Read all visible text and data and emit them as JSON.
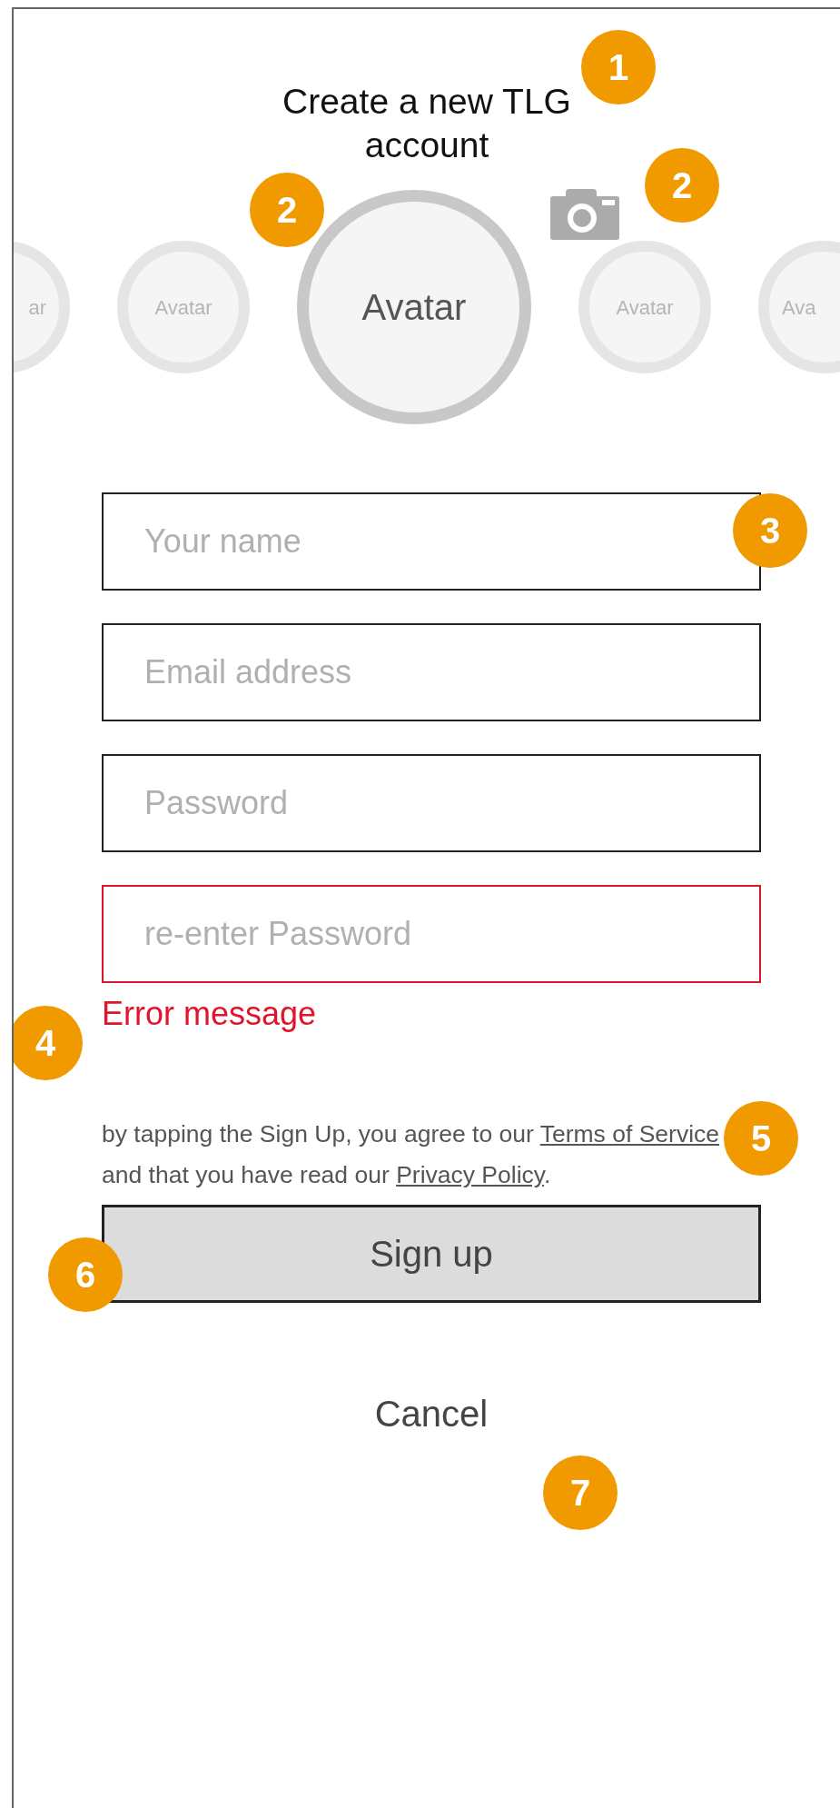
{
  "title": "Create a new TLG account",
  "avatars": [
    {
      "label": "ar",
      "selected": false
    },
    {
      "label": "Avatar",
      "selected": false
    },
    {
      "label": "Avatar",
      "selected": true
    },
    {
      "label": "Avatar",
      "selected": false
    },
    {
      "label": "Ava",
      "selected": false
    }
  ],
  "fields": [
    {
      "placeholder": "Your name",
      "error": false
    },
    {
      "placeholder": "Email address",
      "error": false
    },
    {
      "placeholder": "Password",
      "error": false
    },
    {
      "placeholder": "re-enter Password",
      "error": true
    }
  ],
  "error_message": "Error message",
  "terms": [
    {
      "kind": "text",
      "text": "by tapping the Sign Up, you agree to our "
    },
    {
      "kind": "link",
      "text": "Terms of Service"
    },
    {
      "kind": "text",
      "text": " and that you have read our "
    },
    {
      "kind": "link",
      "text": "Privacy Policy"
    },
    {
      "kind": "text",
      "text": "."
    }
  ],
  "sign_up": "Sign up",
  "cancel": "Cancel",
  "annotations": [
    "1",
    "2",
    "2",
    "3",
    "4",
    "5",
    "6",
    "7"
  ]
}
